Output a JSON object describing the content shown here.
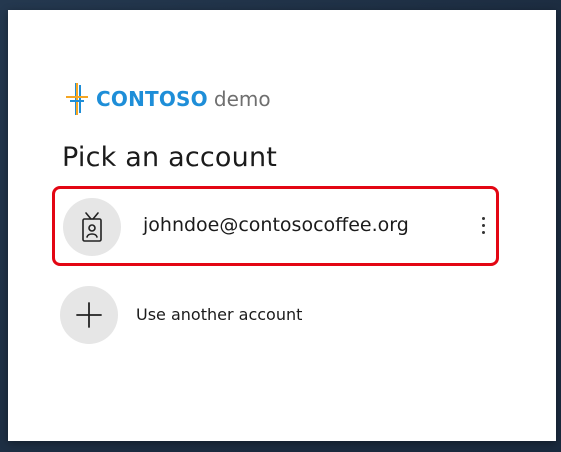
{
  "brand": {
    "name": "CONTOSO",
    "suffix": "demo",
    "colors": {
      "bar_orange": "#f5a623",
      "bar_blue": "#1e8ed8",
      "text_blue": "#1e8ed8"
    }
  },
  "page": {
    "title": "Pick an account"
  },
  "accounts": [
    {
      "email": "johndoe@contosocoffee.org",
      "icon": "id-badge-icon",
      "menu_icon": "more-options-icon"
    }
  ],
  "another_account": {
    "label": "Use another account",
    "icon": "plus-icon"
  },
  "colors": {
    "highlight_border": "#e30613",
    "avatar_bg": "#e6e6e6"
  }
}
